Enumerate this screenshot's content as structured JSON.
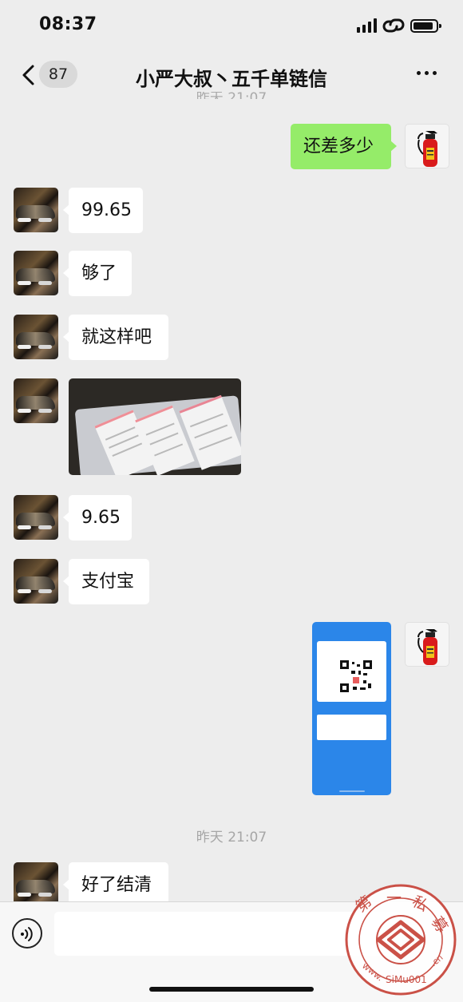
{
  "status_bar": {
    "time": "08:37"
  },
  "header": {
    "unread_count": "87",
    "title": "小严大叔丶五千单链信"
  },
  "chat": {
    "clipped_timestamp": "昨天 21:07",
    "messages": [
      {
        "side": "self",
        "type": "text",
        "text": "还差多少"
      },
      {
        "side": "other",
        "type": "text",
        "text": "99.65"
      },
      {
        "side": "other",
        "type": "text",
        "text": "够了"
      },
      {
        "side": "other",
        "type": "text",
        "text": "就这样吧"
      },
      {
        "side": "other",
        "type": "image",
        "image": "document-photo"
      },
      {
        "side": "other",
        "type": "text",
        "text": "9.65"
      },
      {
        "side": "other",
        "type": "text",
        "text": "支付宝"
      },
      {
        "side": "self",
        "type": "image",
        "image": "payment-qr-screenshot"
      },
      {
        "side": "other",
        "type": "text",
        "text": "好了结清"
      }
    ],
    "timestamp": "昨天 21:07"
  },
  "input": {
    "value": "",
    "placeholder": ""
  },
  "icons": {
    "back": "back-chevron-icon",
    "more": "more-dots-icon",
    "voice": "voice-icon",
    "self_avatar": "fire-extinguisher-icon"
  },
  "watermark": {
    "text": "第一私募 www.SiMu001.cn"
  },
  "colors": {
    "background": "#ededed",
    "self_bubble": "#95ec69",
    "other_bubble": "#ffffff",
    "qr_blue": "#2b86e9"
  }
}
